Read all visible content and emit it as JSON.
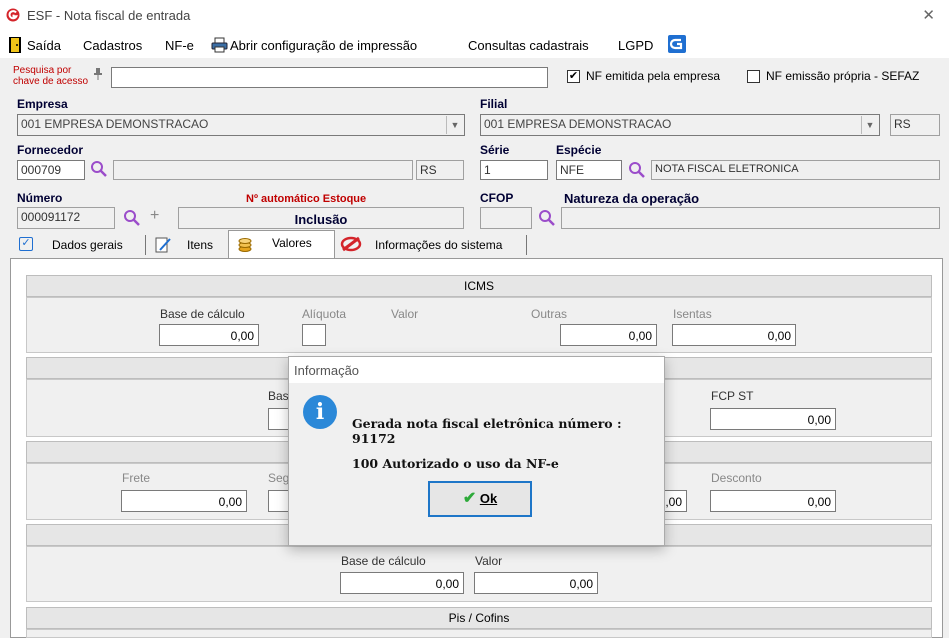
{
  "window": {
    "title": "ESF - Nota fiscal de entrada",
    "close_glyph": "✕"
  },
  "menu": {
    "items": [
      "Saída",
      "Cadastros",
      "NF-e",
      "Abrir configuração de impressão",
      "Consultas cadastrais",
      "LGPD"
    ]
  },
  "search": {
    "label_line1": "Pesquisa por",
    "label_line2": "chave de acesso",
    "value": "",
    "chk_emitida_label": "NF emitida pela empresa",
    "chk_emissao_label": "NF emissão própria - SEFAZ"
  },
  "empresa": {
    "label": "Empresa",
    "value": "001 EMPRESA DEMONSTRACAO"
  },
  "filial": {
    "label": "Filial",
    "value": "001 EMPRESA DEMONSTRACAO",
    "uf": "RS"
  },
  "fornecedor": {
    "label": "Fornecedor",
    "code": "000709",
    "uf": "RS"
  },
  "serie": {
    "label": "Série",
    "value": "1"
  },
  "especie": {
    "label": "Espécie",
    "code": "NFE",
    "desc": "NOTA FISCAL ELETRONICA"
  },
  "numero": {
    "label": "Número",
    "value": "000091172"
  },
  "auto": {
    "label": "Nº automático Estoque",
    "mode": "Inclusão"
  },
  "cfop": {
    "label": "CFOP"
  },
  "natureza": {
    "label": "Natureza da operação"
  },
  "tabs": [
    "Dados gerais",
    "Itens",
    "Valores",
    "Informações do sistema"
  ],
  "icms": {
    "title": "ICMS",
    "base_label": "Base de cálculo",
    "base_value": "0,00",
    "aliq_label": "Alíquota",
    "valor_label": "Valor",
    "outras_label": "Outras",
    "outras_value": "0,00",
    "isentas_label": "Isentas",
    "isentas_value": "0,00"
  },
  "sec2": {
    "base_label": "Bas",
    "fcp_label": "FCP ST",
    "fcp_value": "0,00"
  },
  "sec3": {
    "frete_label": "Frete",
    "frete_value": "0,00",
    "seg_label": "Seg",
    "mid_value": "0,00",
    "desconto_label": "Desconto",
    "desconto_value": "0,00"
  },
  "sec4": {
    "base_label": "Base de cálculo",
    "base_value": "0,00",
    "valor_label": "Valor",
    "valor_value": "0,00"
  },
  "piscofins": {
    "title": "Pis / Cofins"
  },
  "dialog": {
    "title": "Informação",
    "line1": "Gerada nota fiscal eletrônica número : 91172",
    "line2": "100 Autorizado o uso da NF-e",
    "ok_label": "Ok",
    "icon_glyph": "i"
  },
  "colors": {
    "accent": "#1e76c8",
    "brand_red": "#d4242a",
    "search_purple": "#9b4dca",
    "label_red": "#c00000"
  }
}
